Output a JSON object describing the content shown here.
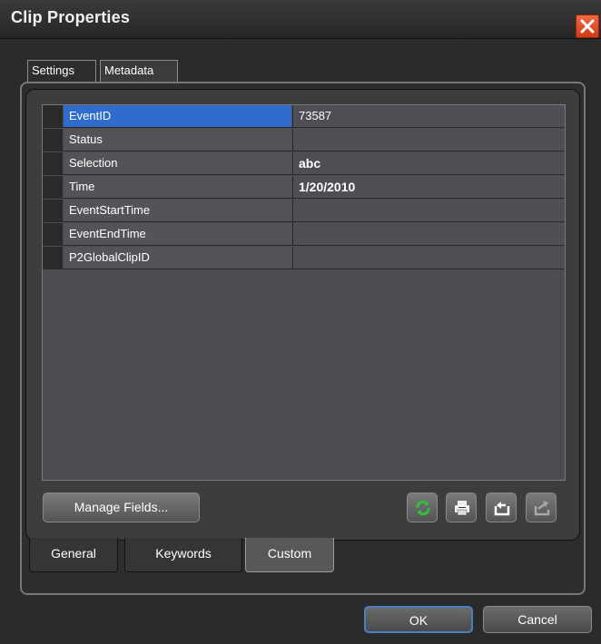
{
  "window": {
    "title": "Clip Properties"
  },
  "top_tabs": [
    {
      "label": "Settings",
      "active": false
    },
    {
      "label": "Metadata",
      "active": true
    }
  ],
  "metadata_grid": {
    "rows": [
      {
        "name": "EventID",
        "value": "73587",
        "selected": true
      },
      {
        "name": "Status",
        "value": ""
      },
      {
        "name": "Selection",
        "value": "abc"
      },
      {
        "name": "Time",
        "value": "1/20/2010"
      },
      {
        "name": "EventStartTime",
        "value": ""
      },
      {
        "name": "EventEndTime",
        "value": ""
      },
      {
        "name": "P2GlobalClipID",
        "value": ""
      }
    ]
  },
  "toolbar": {
    "manage_fields_label": "Manage Fields...",
    "icons": [
      "refresh-icon",
      "print-icon",
      "import-icon",
      "export-icon"
    ]
  },
  "bottom_tabs": [
    {
      "label": "General"
    },
    {
      "label": "Keywords"
    },
    {
      "label": "Custom",
      "active": true
    }
  ],
  "dialog_buttons": {
    "ok_label": "OK",
    "cancel_label": "Cancel"
  },
  "colors": {
    "selection": "#2f6ccc",
    "close_button": "#e0491f",
    "refresh_icon": "#2fbf3a"
  }
}
